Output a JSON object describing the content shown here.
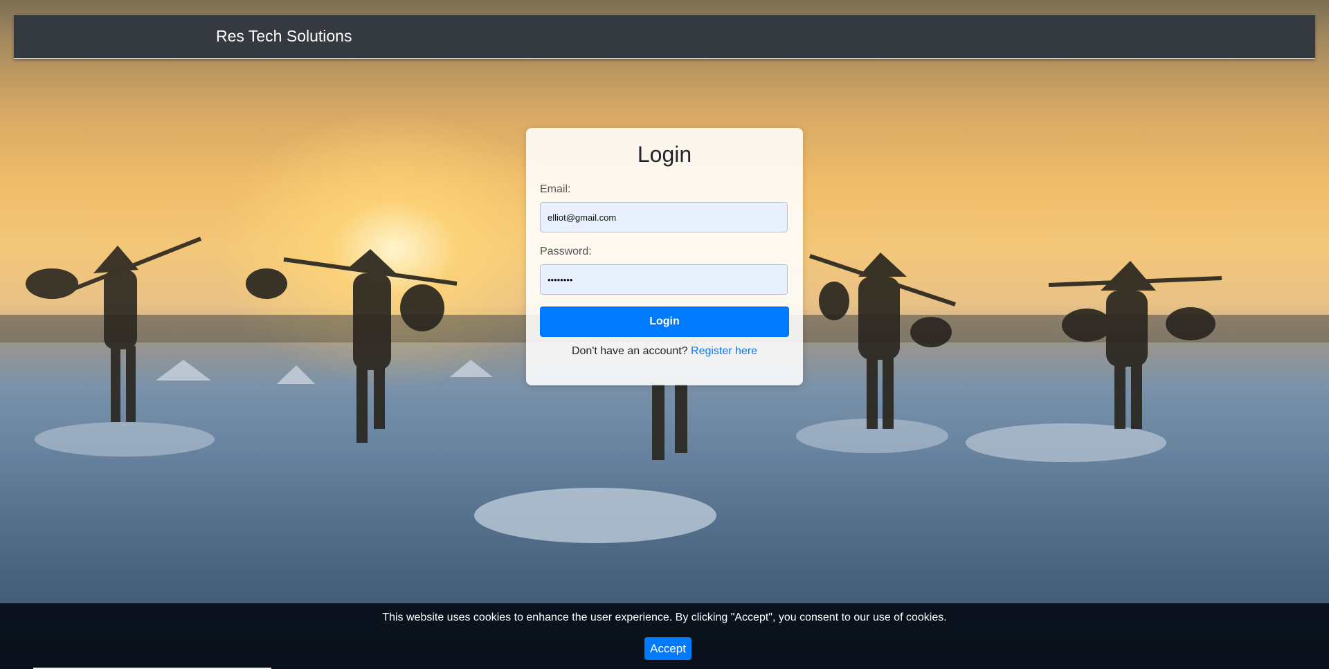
{
  "navbar": {
    "brand": "Res Tech Solutions"
  },
  "login_form": {
    "title": "Login",
    "email_label": "Email:",
    "email_value": "elliot@gmail.com",
    "password_label": "Password:",
    "password_value": "password",
    "submit_label": "Login",
    "register_prompt": "Don't have an account?",
    "register_link": "Register here"
  },
  "cookie_banner": {
    "message": "This website uses cookies to enhance the user experience. By clicking \"Accept\", you consent to our use of cookies.",
    "accept_label": "Accept"
  },
  "colors": {
    "navbar_bg": "#343a40",
    "primary": "#007bff",
    "cookie_bg": "#0b121c"
  }
}
